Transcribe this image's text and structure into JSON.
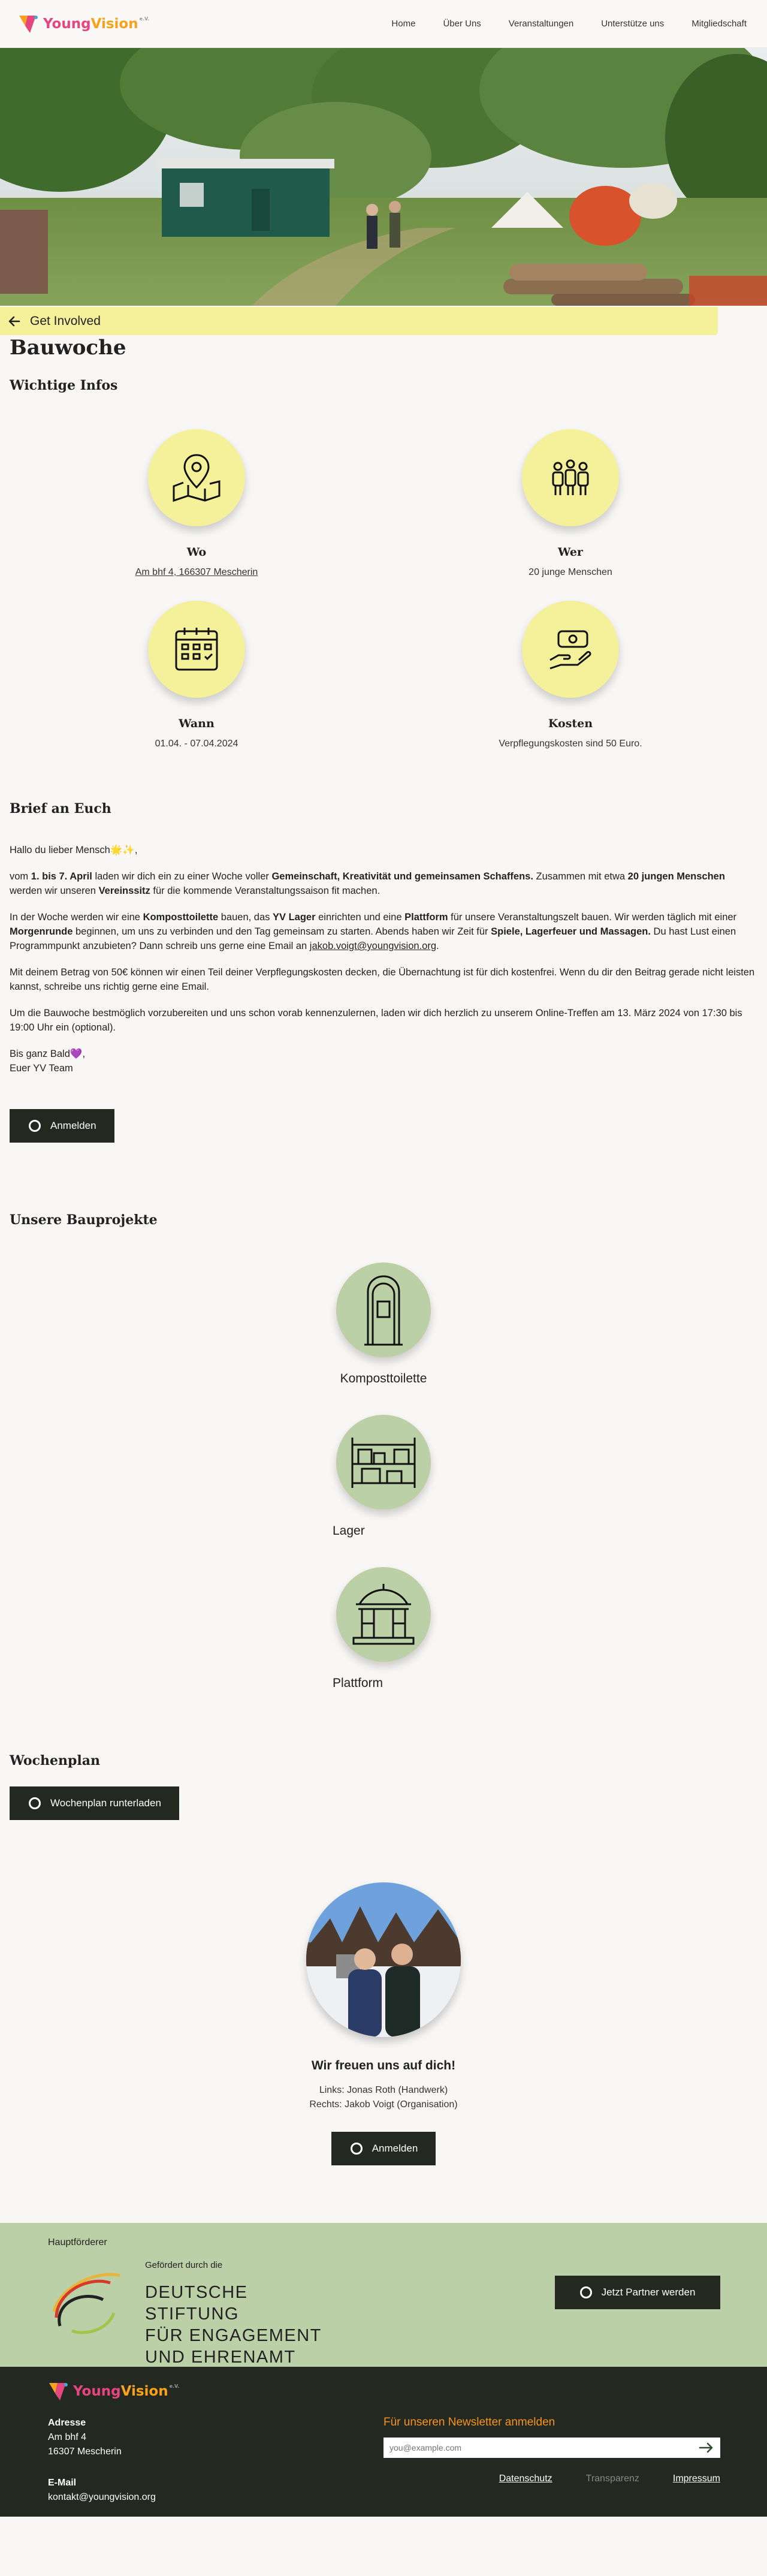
{
  "header": {
    "logo_text_young": "Young",
    "logo_text_vision": "Vision",
    "logo_sup": "e.V.",
    "nav": [
      "Home",
      "Über Uns",
      "Veranstaltungen",
      "Unterstütze uns",
      "Mitgliedschaft"
    ]
  },
  "back_link": "Get Involved",
  "title": "Bauwoche",
  "info": {
    "heading": "Wichtige Infos",
    "cards": [
      {
        "title": "Wo",
        "text": "Am bhf 4, 166307 Mescherin",
        "icon": "map-pin-icon"
      },
      {
        "title": "Wer",
        "text": "20 junge Menschen",
        "icon": "group-icon"
      },
      {
        "title": "Wann",
        "text": "01.04. - 07.04.2024",
        "icon": "calendar-icon"
      },
      {
        "title": "Kosten",
        "text": "Verpflegungskosten sind 50 Euro.",
        "icon": "money-hand-icon"
      }
    ]
  },
  "letter": {
    "heading": "Brief an Euch",
    "greeting": "Hallo du lieber Mensch",
    "greeting_emoji": "🌟✨,",
    "p1_a": "vom ",
    "p1_b": "1. bis 7. April",
    "p1_c": " laden wir dich ein zu einer Woche voller ",
    "p1_d": "Gemeinschaft, Kreativität und gemeinsamen Schaffens.",
    "p1_e": " Zusammen mit etwa ",
    "p1_f": "20 jungen Menschen",
    "p1_g": " werden wir unseren ",
    "p1_h": "Vereinssitz",
    "p1_i": " für die kommende Veranstaltungssaison fit machen.",
    "p2_a": "In der Woche werden wir eine ",
    "p2_b": "Komposttoilette",
    "p2_c": " bauen, das ",
    "p2_d": "YV Lager",
    "p2_e": " einrichten und eine ",
    "p2_f": "Plattform",
    "p2_g": " für unsere Veranstaltungszelt bauen. Wir werden täglich mit einer ",
    "p2_h": "Morgenrunde",
    "p2_i": " beginnen, um uns zu verbinden und den Tag gemeinsam zu starten. Abends haben wir Zeit für ",
    "p2_j": "Spiele, Lagerfeuer und Massagen.",
    "p2_k": " Du hast Lust einen Programmpunkt anzubieten? Dann schreib uns gerne eine Email an ",
    "p2_email": "jakob.voigt@youngvision.org",
    "p2_l": ".",
    "p3": "Mit deinem Betrag von 50€ können wir einen Teil deiner Verpflegungskosten decken, die Übernachtung ist für dich kostenfrei. Wenn du dir den Beitrag gerade nicht leisten kannst, schreibe uns richtig gerne eine Email.",
    "p4": "Um die Bauwoche bestmöglich vorzubereiten und uns schon vorab kennenzulernen, laden wir dich herzlich zu unserem Online-Treffen am 13. März 2024 von 17:30 bis 19:00 Uhr ein (optional).",
    "closing1": "Bis ganz Bald",
    "closing_emoji": "💜,",
    "closing2": "Euer YV Team",
    "button": "Anmelden"
  },
  "projects": {
    "heading": "Unsere Bauprojekte",
    "items": [
      {
        "label": "Komposttoilette",
        "icon": "outhouse-icon"
      },
      {
        "label": "Lager",
        "icon": "shelf-icon"
      },
      {
        "label": "Plattform",
        "icon": "pavilion-icon"
      }
    ]
  },
  "schedule": {
    "heading": "Wochenplan",
    "button": "Wochenplan runterladen"
  },
  "team": {
    "heading": "Wir freuen uns auf dich!",
    "line1": "Links: Jonas Roth (Handwerk)",
    "line2": "Rechts: Jakob Voigt (Organisation)",
    "button": "Anmelden"
  },
  "sponsor": {
    "label": "Hauptförderer",
    "gefoerdert": "Gefördert durch die",
    "line1": "DEUTSCHE STIFTUNG",
    "line2": "FÜR ENGAGEMENT",
    "line3": "UND EHRENAMT",
    "button": "Jetzt Partner werden"
  },
  "footer": {
    "address_label": "Adresse",
    "address_line1": "Am bhf 4",
    "address_line2": "16307 Mescherin",
    "email_label": "E-Mail",
    "email": "kontakt@youngvision.org",
    "newsletter_title": "Für unseren Newsletter anmelden",
    "newsletter_placeholder": "you@example.com",
    "links": [
      "Datenschutz",
      "Transparenz",
      "Impressum"
    ]
  },
  "colors": {
    "accent_yellow": "#f5f09a",
    "accent_green": "#bcd0a7",
    "dark": "#232820",
    "newsletter_orange": "#f7931e"
  }
}
